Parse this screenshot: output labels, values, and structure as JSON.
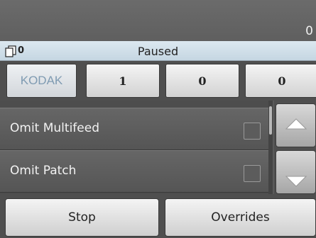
{
  "header": {
    "count": "0"
  },
  "status": {
    "page_count": "0",
    "state": "Paused"
  },
  "counters": [
    {
      "label": "KODAK"
    },
    {
      "label": "1"
    },
    {
      "label": "0"
    },
    {
      "label": "0"
    }
  ],
  "options": [
    {
      "label": "Omit Multifeed",
      "checked": false
    },
    {
      "label": "Omit Patch",
      "checked": false
    }
  ],
  "actions": {
    "stop_label": "Stop",
    "overrides_label": "Overrides"
  },
  "icons": {
    "pages": "pages-icon",
    "scroll_up": "arrow-up-icon",
    "scroll_down": "arrow-down-icon"
  },
  "colors": {
    "brand": "#7f9bb2",
    "status_bg": "#d2e0ea"
  }
}
